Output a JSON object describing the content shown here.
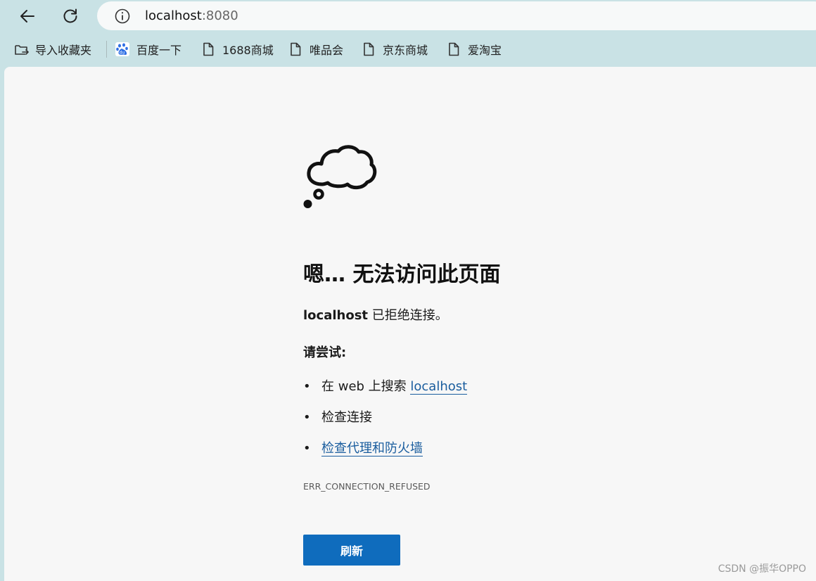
{
  "toolbar": {
    "back_icon": "back-arrow-icon",
    "refresh_icon": "refresh-icon",
    "address": {
      "info_icon": "info-circle-icon",
      "host": "localhost",
      "port": ":8080"
    }
  },
  "bookmarks": {
    "items": [
      {
        "label": "导入收藏夹",
        "icon": "import-favorites-icon"
      },
      {
        "label": "百度一下",
        "icon": "baidu-paw-icon"
      },
      {
        "label": "1688商城",
        "icon": "page-icon"
      },
      {
        "label": "唯品会",
        "icon": "page-icon"
      },
      {
        "label": "京东商城",
        "icon": "page-icon"
      },
      {
        "label": "爱淘宝",
        "icon": "page-icon"
      }
    ]
  },
  "error_page": {
    "title": "嗯… 无法访问此页面",
    "host": "localhost",
    "message": " 已拒绝连接。",
    "try_heading": "请尝试:",
    "suggestions": [
      {
        "prefix": "在 web 上搜索 ",
        "link": "localhost"
      },
      {
        "text": "检查连接"
      },
      {
        "link": "检查代理和防火墙"
      }
    ],
    "bullet": "•",
    "error_code": "ERR_CONNECTION_REFUSED",
    "refresh_label": "刷新"
  },
  "watermark": "CSDN @振华OPPO",
  "colors": {
    "chrome_bg": "#c9e2e5",
    "content_bg": "#f7f7f7",
    "link": "#1a5d9e",
    "button": "#0f6cbd"
  }
}
